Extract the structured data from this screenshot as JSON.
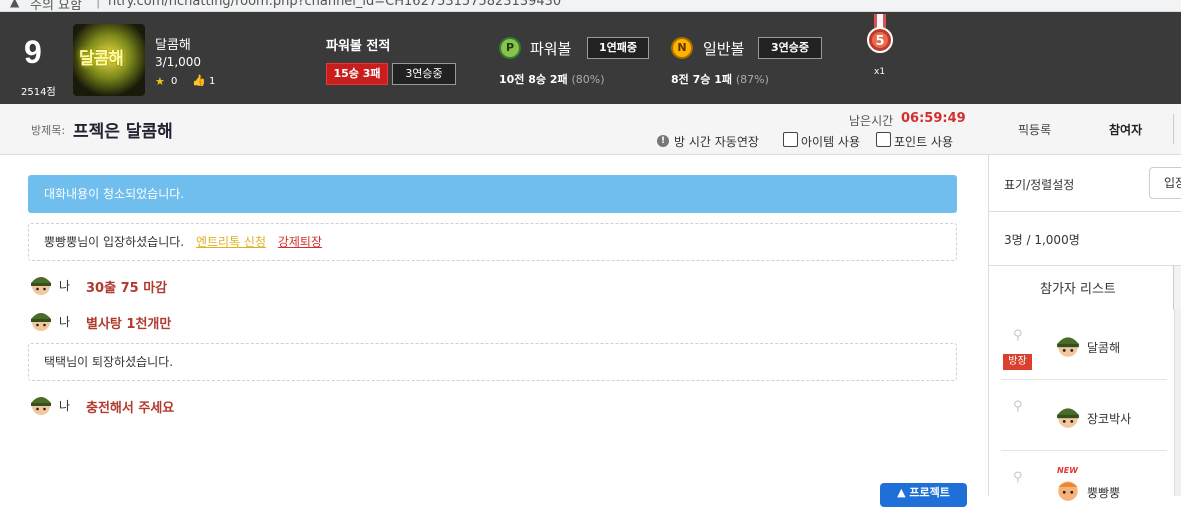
{
  "browser": {
    "warning_text": "주의 요함",
    "url": "ntry.com/nchatting/room.php?channel_id=CH1627531575823139430"
  },
  "header": {
    "level": "9",
    "points": "2514점",
    "logo_text": "달콤해",
    "user_name": "달콤해",
    "user_count": "3/1,000",
    "star_count": "0",
    "like_count": "1",
    "powerball_title": "파워볼 전적",
    "powerball_record": "15승 3패",
    "powerball_streak": "3연승중",
    "games": [
      {
        "icon_letter": "P",
        "label": "파워볼",
        "badge": "1연패중",
        "stat_main": "10전 8승 2패",
        "stat_pct": "(80%)"
      },
      {
        "icon_letter": "N",
        "label": "일반볼",
        "badge": "3연승중",
        "stat_main": "8전 7승 1패",
        "stat_pct": "(87%)"
      }
    ],
    "medal_number": "5",
    "medal_multiplier": "x1"
  },
  "room": {
    "title_label": "방제목:",
    "title": "프젝은 달콤해",
    "remaining_label": "남은시간",
    "remaining_time": "06:59:49",
    "auto_extend_label": "방 시간 자동연장",
    "item_use_label": "아이템 사용",
    "point_use_label": "포인트 사용",
    "tabs": [
      "픽등록",
      "참여자"
    ]
  },
  "chat": {
    "cleared_notice": "대화내용이 청소되었습니다.",
    "join_notice": "뿡빵뿡님이 입장하셨습니다.",
    "entry_link": "엔트리톡 신청",
    "kick_link": "강제퇴장",
    "leave_notice": "택택님이 퇴장하셨습니다.",
    "messages": [
      {
        "who": "나",
        "text": "30출 75 마감"
      },
      {
        "who": "나",
        "text": "별사탕 1천개만"
      },
      {
        "who": "나",
        "text": "충전해서 주세요"
      }
    ],
    "float_button": "▲ 프로젝트"
  },
  "sidebar": {
    "display_setting_label": "표기/정렬설정",
    "display_select_value": "입장",
    "member_count": "3명 / 1,000명",
    "participants_title": "참가자 리스트",
    "host_badge": "방장",
    "new_badge": "NEW",
    "participants": [
      {
        "name": "달콤해"
      },
      {
        "name": "장코박사"
      },
      {
        "name": "뿡빵뿡"
      }
    ]
  },
  "colors": {
    "header_bg": "#3a3a3a",
    "accent_red": "#d32f2f",
    "notice_blue": "#6fbeee",
    "message_text": "#b03a2e",
    "float_button": "#1e6fd8"
  }
}
